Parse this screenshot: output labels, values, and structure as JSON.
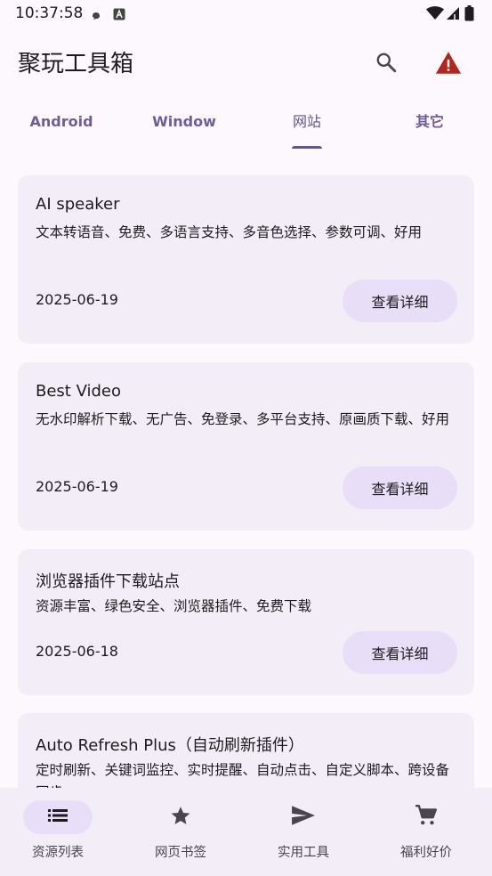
{
  "status_bar": {
    "time": "10:37:58",
    "icons": [
      "notification-dot-icon",
      "a-badge-icon",
      "wifi-icon",
      "signal-icon",
      "battery-icon"
    ]
  },
  "app_bar": {
    "title": "聚玩工具箱",
    "actions": [
      "search-icon",
      "warning-icon"
    ],
    "warning_color": "#b3261e"
  },
  "tabs": [
    {
      "label": "Android",
      "active": false
    },
    {
      "label": "Window",
      "active": false
    },
    {
      "label": "网站",
      "active": true
    },
    {
      "label": "其它",
      "active": false
    }
  ],
  "cards": [
    {
      "title": "AI speaker",
      "description": "文本转语音、免费、多语言支持、多音色选择、参数可调、好用",
      "date": "2025-06-19",
      "button": "查看详细"
    },
    {
      "title": "Best Video",
      "description": "无水印解析下载、无广告、免登录、多平台支持、原画质下载、好用",
      "date": "2025-06-19",
      "button": "查看详细"
    },
    {
      "title": "浏览器插件下载站点",
      "description": "资源丰富、绿色安全、浏览器插件、免费下载",
      "date": "2025-06-18",
      "button": "查看详细"
    },
    {
      "title": "Auto Refresh Plus（自动刷新插件）",
      "description": "定时刷新、关键词监控、实时提醒、自动点击、自定义脚本、跨设备同步",
      "date": "",
      "button": ""
    }
  ],
  "bottom_nav": [
    {
      "label": "资源列表",
      "icon": "list-icon",
      "active": true
    },
    {
      "label": "网页书签",
      "icon": "star-icon",
      "active": false
    },
    {
      "label": "实用工具",
      "icon": "send-icon",
      "active": false
    },
    {
      "label": "福利好价",
      "icon": "cart-icon",
      "active": false
    }
  ],
  "colors": {
    "background": "#fdf7fe",
    "card": "#f3edf7",
    "primary": "#65558f",
    "button_tonal": "#e8def8",
    "nav_bar": "#f3edf7"
  }
}
